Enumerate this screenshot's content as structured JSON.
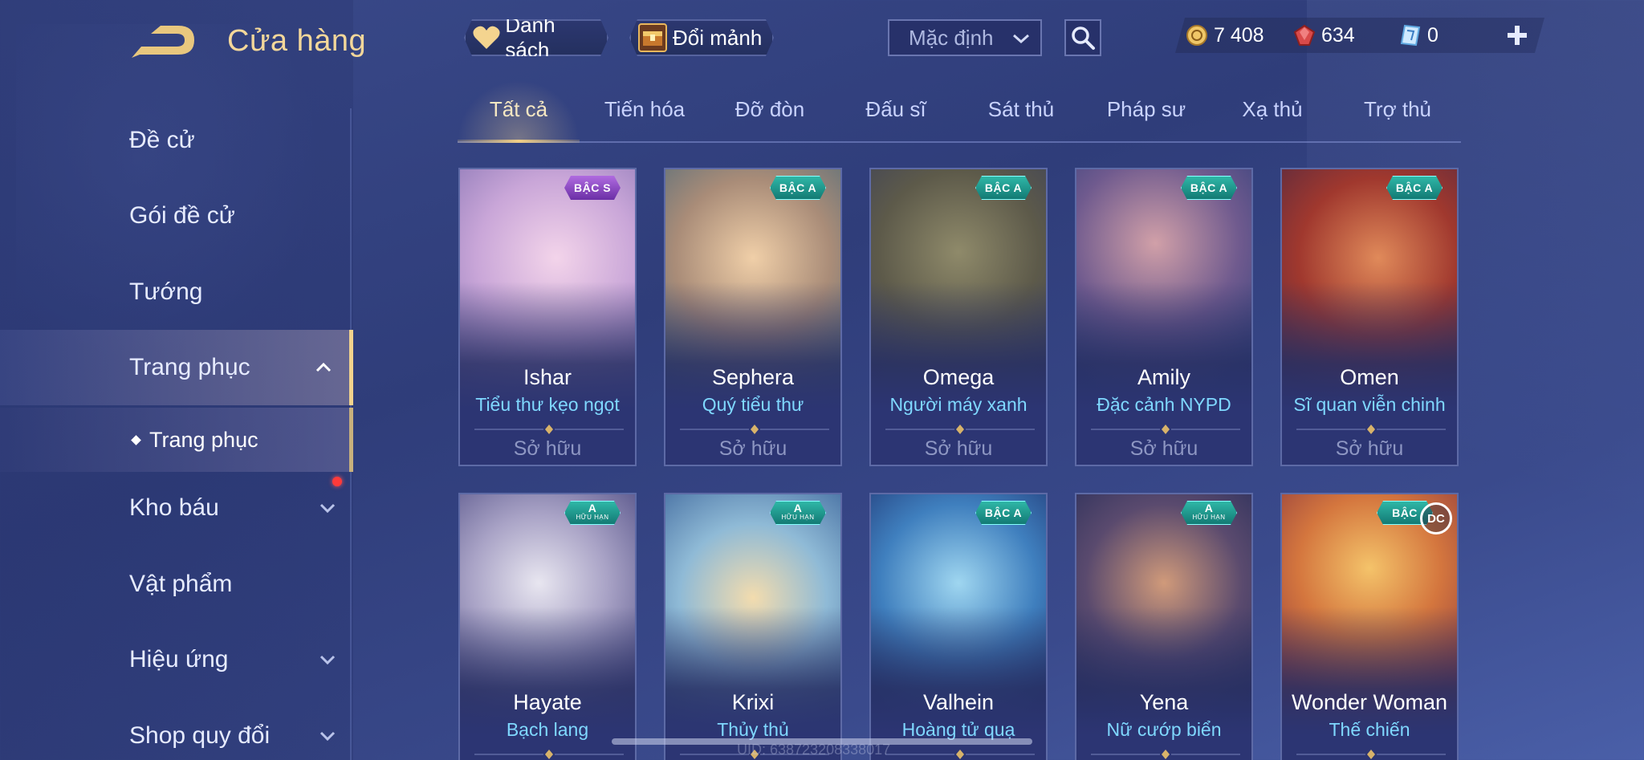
{
  "header": {
    "title": "Cửa hàng",
    "list_button": "Danh sách",
    "exchange_button": "Đổi mảnh",
    "sort_value": "Mặc định"
  },
  "currency": {
    "gold": "7 408",
    "ruby": "634",
    "voucher": "0"
  },
  "sidebar": {
    "items": [
      {
        "label": "Đề cử"
      },
      {
        "label": "Gói đề cử"
      },
      {
        "label": "Tướng"
      },
      {
        "label": "Trang phục"
      },
      {
        "label": "Kho báu"
      },
      {
        "label": "Vật phẩm"
      },
      {
        "label": "Hiệu ứng"
      },
      {
        "label": "Shop quy đổi"
      }
    ],
    "sub_item": "Trang phục"
  },
  "tabs": [
    "Tất cả",
    "Tiến hóa",
    "Đỡ đòn",
    "Đấu sĩ",
    "Sát thủ",
    "Pháp sư",
    "Xạ thủ",
    "Trợ thủ"
  ],
  "cards": [
    {
      "hero": "Ishar",
      "skin": "Tiểu thư kẹo ngọt",
      "status": "Sở hữu",
      "badge": "BẬC S"
    },
    {
      "hero": "Sephera",
      "skin": "Quý tiểu thư",
      "status": "Sở hữu",
      "badge": "BẬC A"
    },
    {
      "hero": "Omega",
      "skin": "Người máy xanh",
      "status": "Sở hữu",
      "badge": "BẬC A"
    },
    {
      "hero": "Amily",
      "skin": "Đặc cảnh NYPD",
      "status": "Sở hữu",
      "badge": "BẬC A"
    },
    {
      "hero": "Omen",
      "skin": "Sĩ quan viễn chinh",
      "status": "Sở hữu",
      "badge": "BẬC A"
    },
    {
      "hero": "Hayate",
      "skin": "Bạch lang",
      "badge": "A",
      "badge_sub": "HỮU HẠN"
    },
    {
      "hero": "Krixi",
      "skin": "Thủy thủ",
      "badge": "A",
      "badge_sub": "HỮU HẠN"
    },
    {
      "hero": "Valhein",
      "skin": "Hoàng tử quạ",
      "badge": "BẬC A"
    },
    {
      "hero": "Yena",
      "skin": "Nữ cướp biển",
      "badge": "A",
      "badge_sub": "HỮU HẠN"
    },
    {
      "hero": "Wonder Woman",
      "skin": "Thế chiến",
      "badge": "BẬC",
      "logo": "DC"
    }
  ],
  "footer": {
    "uid": "UID: 638723208338017"
  },
  "colors": {
    "accent_gold": "#f2d38d",
    "skin_name": "#7fd8ff",
    "background": "#33427e"
  }
}
